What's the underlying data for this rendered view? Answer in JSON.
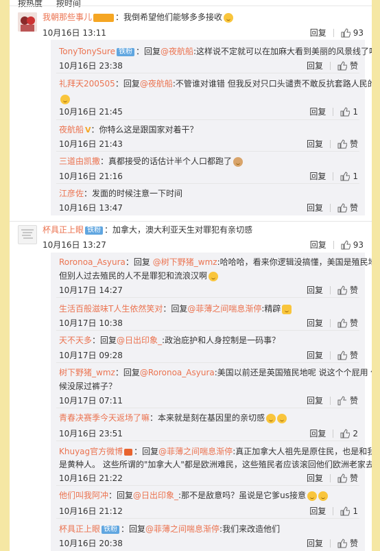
{
  "sort_tabs": [
    "按热度",
    "按时间"
  ],
  "ui": {
    "reply_label": "回复",
    "like_placeholder": "赞"
  },
  "comments": [
    {
      "user": "我朝那些事儿",
      "text": "：我倒希望他们能够多多接收",
      "time": "10月16日 13:11",
      "likes": "93",
      "replies": [
        {
          "user": "TonyTonySure",
          "badge": "铁粉",
          "mid": "：回复",
          "at": "@夜航船",
          "text": ":这样说不定就可以在加麻大看到美丽的风景线了呀",
          "time": "10月16日 23:38",
          "likes": "赞"
        },
        {
          "user": "礼拜天200505",
          "mid": "：回复",
          "at": "@夜航船",
          "text": ":不管谁对谁错  但我反对只口头谴责不敢反抗套路人民的国家",
          "time": "10月16日 21:45",
          "likes": "1"
        },
        {
          "user": "夜航船",
          "mid": "",
          "at": "",
          "text": "：你特么这是跟国家对着干？",
          "time": "10月16日 21:43",
          "likes": "赞"
        },
        {
          "user": "三道由凯撒",
          "mid": "",
          "at": "",
          "text": "：真都接受的话估计半个人口都跑了",
          "time": "10月16日 21:16",
          "likes": "1"
        },
        {
          "user": "江彦佐",
          "mid": "",
          "at": "",
          "text": "：发面的时候注意一下时间",
          "time": "10月16日 13:47",
          "likes": "赞"
        }
      ]
    },
    {
      "user": "杯具正上眼",
      "badge": "铁粉",
      "text": "：加拿大，澳大利亚天生对罪犯有亲切感",
      "time": "10月16日 13:27",
      "likes": "93",
      "replies": [
        {
          "user": "Roronoa_Asyura",
          "mid": "：回复 ",
          "at": "@树下野猪_wmz",
          "text": ":哈哈哈，看来你逻辑没搞懂，美国是殖民地没错，",
          "text2": "但别人过去殖民的人不是罪犯和流浪汉啊",
          "time": "10月17日 14:27",
          "likes": "赞"
        },
        {
          "user": "生活百般滋味T人生依然笑对",
          "mid": "：回复",
          "at": "@菲薄之间喘息渐停",
          "text": ":精辟",
          "time": "10月17日 10:38",
          "likes": "赞"
        },
        {
          "user": "天不天多",
          "mid": "：回复",
          "at": "@日出印象_",
          "text": ":政治庇护和人身控制是一码事？",
          "time": "10月17日 09:28",
          "likes": "赞"
        },
        {
          "user": "树下野猪_wmz",
          "mid": "：回复",
          "at": "@Roronoa_Asyura",
          "text": ":美国以前还是英国殖民地呢  说这个个屁用  你小时",
          "text2": "候没尿过裤子？",
          "time": "10月17日 07:11",
          "likes": "赞"
        },
        {
          "user": "青春决赛季今天返场了嘛",
          "mid": "",
          "at": "",
          "text": "：本来就是刻在基因里的亲切感",
          "time": "10月16日 23:51",
          "likes": "2"
        },
        {
          "user": "Khuyag官方微博",
          "mid": "：回复",
          "at": "@菲薄之间喘息渐停",
          "text": ":真正加拿大人祖先是原住民，也是和我们一样",
          "text2": "是黄种人。  这些所谓的\"加拿大人\"都是欧洲难民，这些殖民者应该滚回他们欧洲老家去要饭",
          "time": "10月16日 21:22",
          "likes": "赞"
        },
        {
          "user": "他们叫我阿冲",
          "mid": "：回复",
          "at": "@日出印象_",
          "text": ":那不是敌意吗？虽说是它爹us接意",
          "time": "10月16日 21:12",
          "likes": "1"
        },
        {
          "user": "杯具正上眼",
          "badge": "铁粉",
          "mid": "：回复",
          "at": "@菲薄之间喘息渐停",
          "text": ":我们来改造他们",
          "time": "10月16日 20:38",
          "likes": "赞"
        }
      ]
    }
  ],
  "colors": {
    "page_bg": "#f5e7a4",
    "username": "#eb7350",
    "reply_bg": "#f2f2f5",
    "badge": "#60a6e0"
  }
}
